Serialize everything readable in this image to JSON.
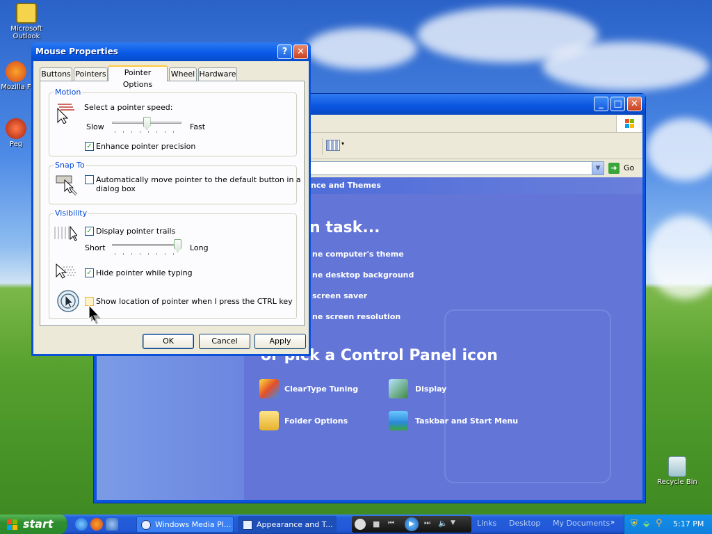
{
  "desktop": {
    "icons": [
      {
        "label": "Microsoft Outlook",
        "icon": "outlook-icon"
      },
      {
        "label": "Mozilla F",
        "icon": "firefox-icon"
      },
      {
        "label": "Peg",
        "icon": "pegasus-icon"
      },
      {
        "label": "Recycle Bin",
        "icon": "recycle-bin-icon"
      }
    ]
  },
  "explorer": {
    "category_title": "nce and Themes",
    "pick_task_heading": "n task...",
    "tasks": [
      "ne computer's theme",
      "ne desktop background",
      "screen saver",
      "ne screen resolution"
    ],
    "pick_icon_heading": "or pick a Control Panel icon",
    "icons": [
      {
        "label": "ClearType Tuning",
        "icon": "cleartype-icon"
      },
      {
        "label": "Display",
        "icon": "display-icon"
      },
      {
        "label": "Folder Options",
        "icon": "folder-options-icon"
      },
      {
        "label": "Taskbar and Start Menu",
        "icon": "taskbar-icon"
      }
    ],
    "go_label": "Go"
  },
  "dialog": {
    "title": "Mouse Properties",
    "tabs": [
      "Buttons",
      "Pointers",
      "Pointer Options",
      "Wheel",
      "Hardware"
    ],
    "active_tab": "Pointer Options",
    "motion": {
      "legend": "Motion",
      "speed_label": "Select a pointer speed:",
      "slow": "Slow",
      "fast": "Fast",
      "speed_value": 0.5,
      "precision_label": "Enhance pointer precision",
      "precision_checked": true
    },
    "snap": {
      "legend": "Snap To",
      "label_line1": "Automatically move pointer to the default button in a",
      "label_line2": "dialog box",
      "checked": false
    },
    "visibility": {
      "legend": "Visibility",
      "trails_label": "Display pointer trails",
      "trails_checked": true,
      "short": "Short",
      "long": "Long",
      "trail_value": 1.0,
      "hide_label": "Hide pointer while typing",
      "hide_checked": true,
      "ctrl_label": "Show location of pointer when I press the CTRL key",
      "ctrl_checked": false
    },
    "buttons": {
      "ok": "OK",
      "cancel": "Cancel",
      "apply": "Apply"
    }
  },
  "taskbar": {
    "start": "start",
    "tasks": [
      {
        "label": "Windows Media Pl...",
        "active": false
      },
      {
        "label": "Appearance and T...",
        "active": true
      }
    ],
    "links": [
      "Links",
      "Desktop",
      "My Documents"
    ],
    "clock": "5:17 PM"
  }
}
